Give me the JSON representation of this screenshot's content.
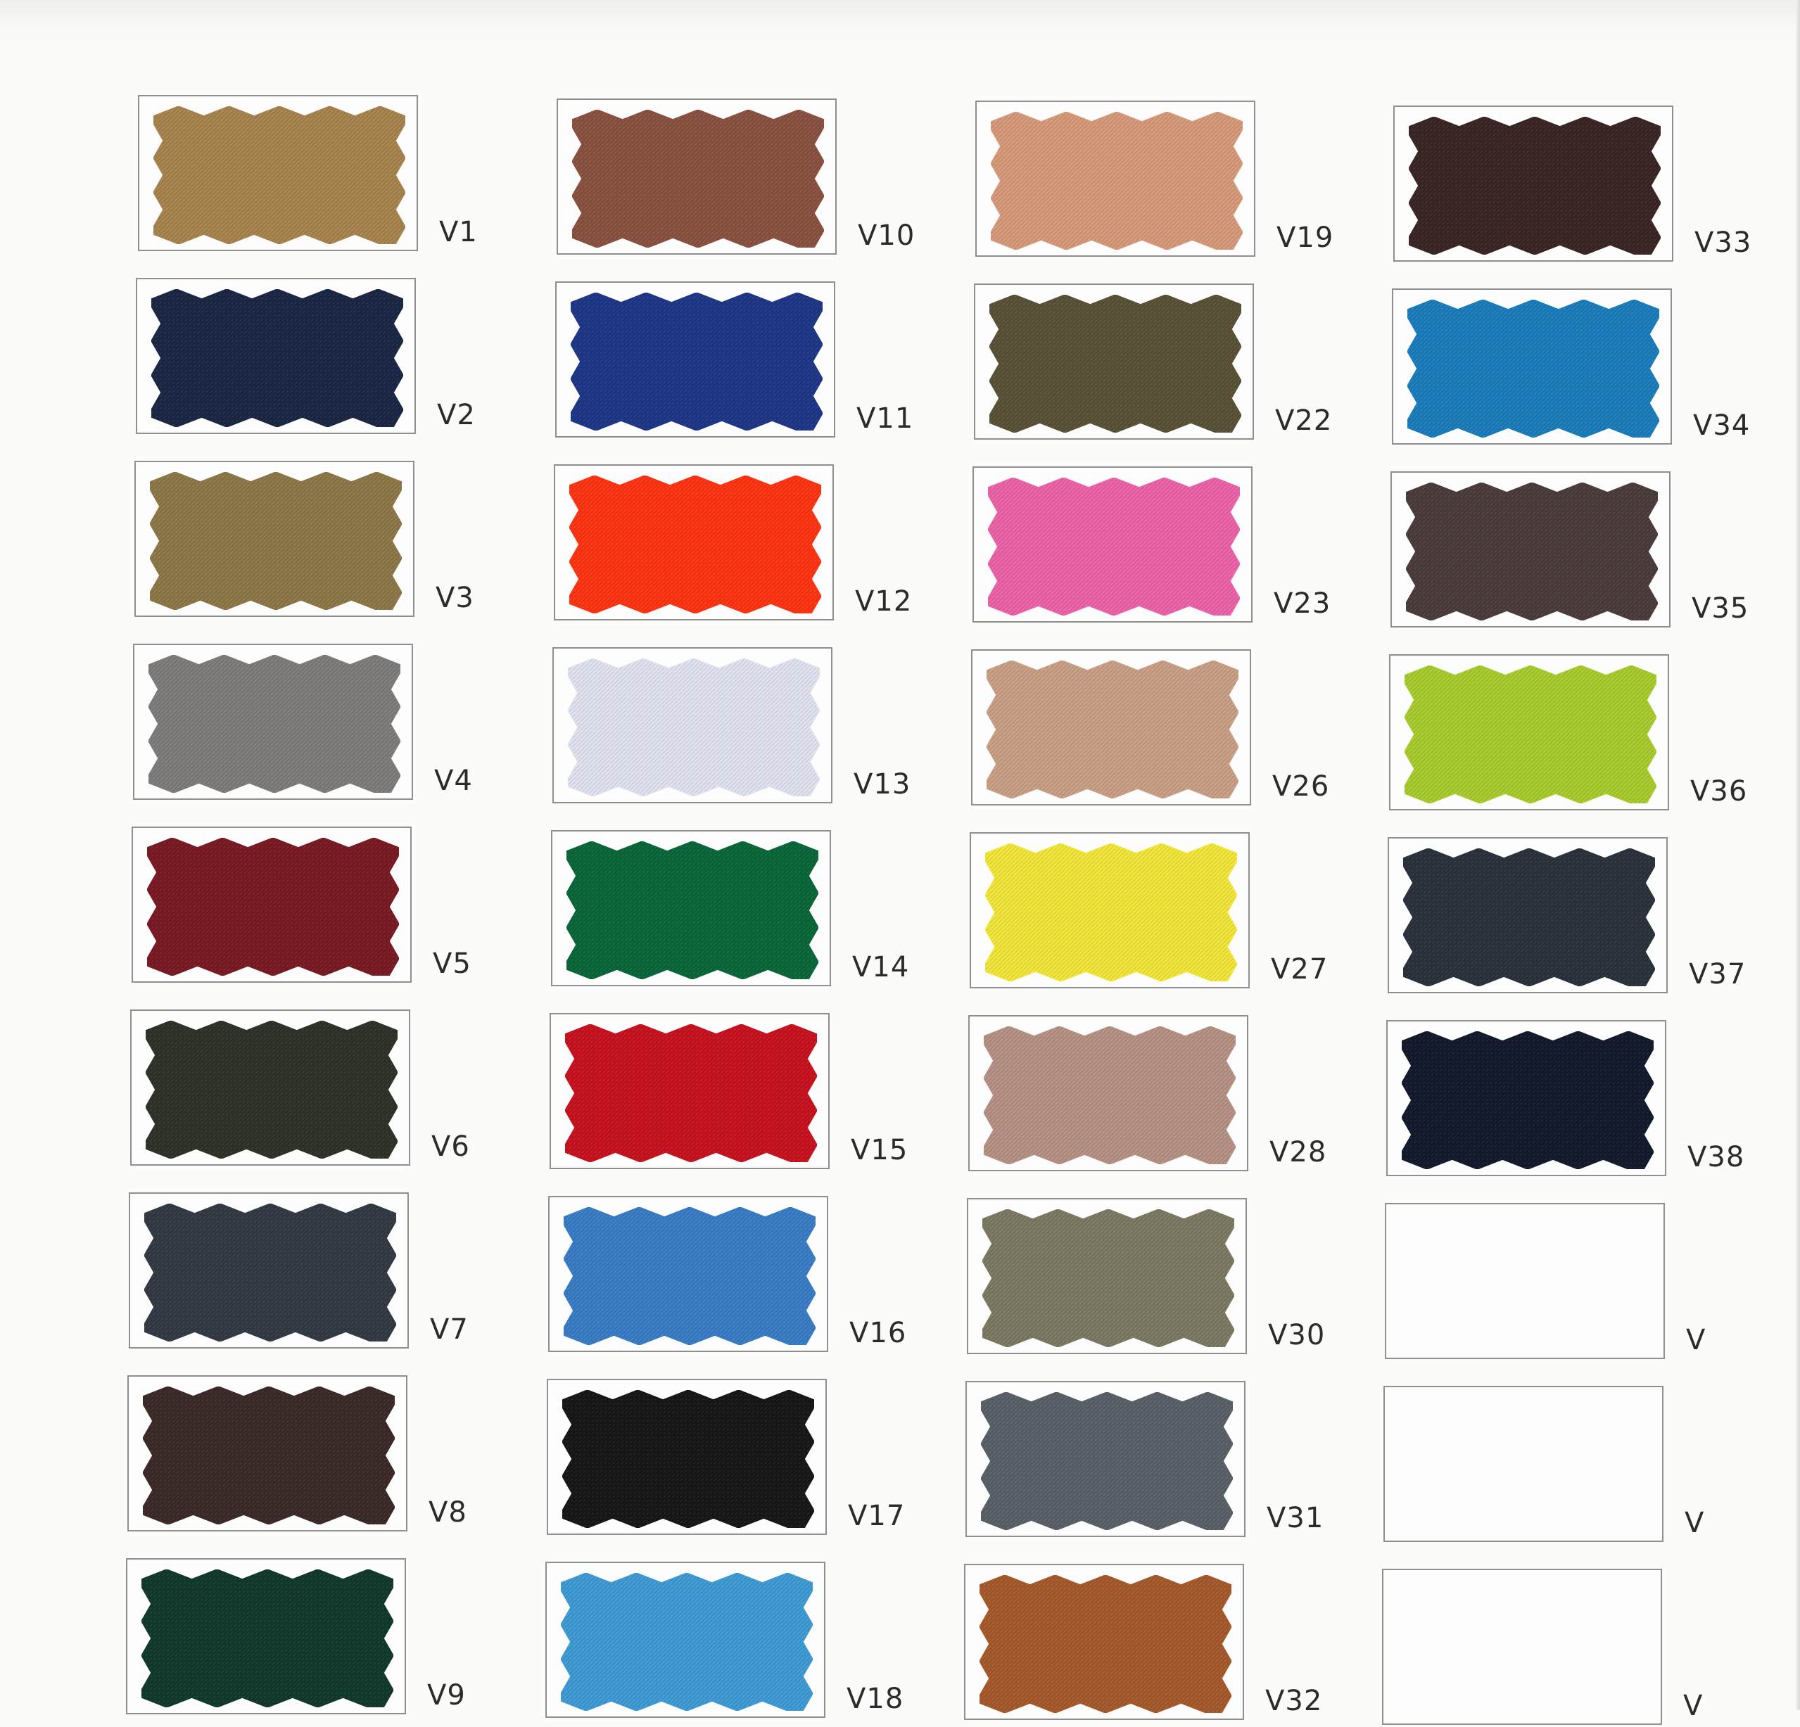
{
  "chart": {
    "columns": [
      {
        "swatches": [
          {
            "code": "V1",
            "color": "#a8844e"
          },
          {
            "code": "V2",
            "color": "#1b2744"
          },
          {
            "code": "V3",
            "color": "#8d7848"
          },
          {
            "code": "V4",
            "color": "#7f7c7c"
          },
          {
            "code": "V5",
            "color": "#7a1a24"
          },
          {
            "code": "V6",
            "color": "#2e3228"
          },
          {
            "code": "V7",
            "color": "#323a44"
          },
          {
            "code": "V8",
            "color": "#3b2a28"
          },
          {
            "code": "V9",
            "color": "#113a2c"
          }
        ]
      },
      {
        "swatches": [
          {
            "code": "V10",
            "color": "#8a5240"
          },
          {
            "code": "V11",
            "color": "#1e3787"
          },
          {
            "code": "V12",
            "color": "#ff3412"
          },
          {
            "code": "V13",
            "color": "#e0e3ef"
          },
          {
            "code": "V14",
            "color": "#0a673a"
          },
          {
            "code": "V15",
            "color": "#c8121f"
          },
          {
            "code": "V16",
            "color": "#3a7dc6"
          },
          {
            "code": "V17",
            "color": "#171717"
          },
          {
            "code": "V18",
            "color": "#3f9bd4"
          }
        ]
      },
      {
        "swatches": [
          {
            "code": "V19",
            "color": "#d69a7a"
          },
          {
            "code": "V22",
            "color": "#5a5238"
          },
          {
            "code": "V23",
            "color": "#ec63a8"
          },
          {
            "code": "V26",
            "color": "#c9a086"
          },
          {
            "code": "V27",
            "color": "#f3e63a"
          },
          {
            "code": "V28",
            "color": "#b69284"
          },
          {
            "code": "V30",
            "color": "#7c7a62"
          },
          {
            "code": "V31",
            "color": "#5a6068"
          },
          {
            "code": "V32",
            "color": "#a65a2c"
          }
        ]
      },
      {
        "swatches": [
          {
            "code": "V33",
            "color": "#3a2624"
          },
          {
            "code": "V34",
            "color": "#1b7dbc"
          },
          {
            "code": "V35",
            "color": "#4c3c3c"
          },
          {
            "code": "V36",
            "color": "#a8cc2e"
          },
          {
            "code": "V37",
            "color": "#2a323c"
          },
          {
            "code": "V38",
            "color": "#121a2c"
          },
          {
            "code": "V",
            "color": ""
          },
          {
            "code": "V",
            "color": ""
          },
          {
            "code": "V",
            "color": ""
          }
        ]
      }
    ]
  }
}
